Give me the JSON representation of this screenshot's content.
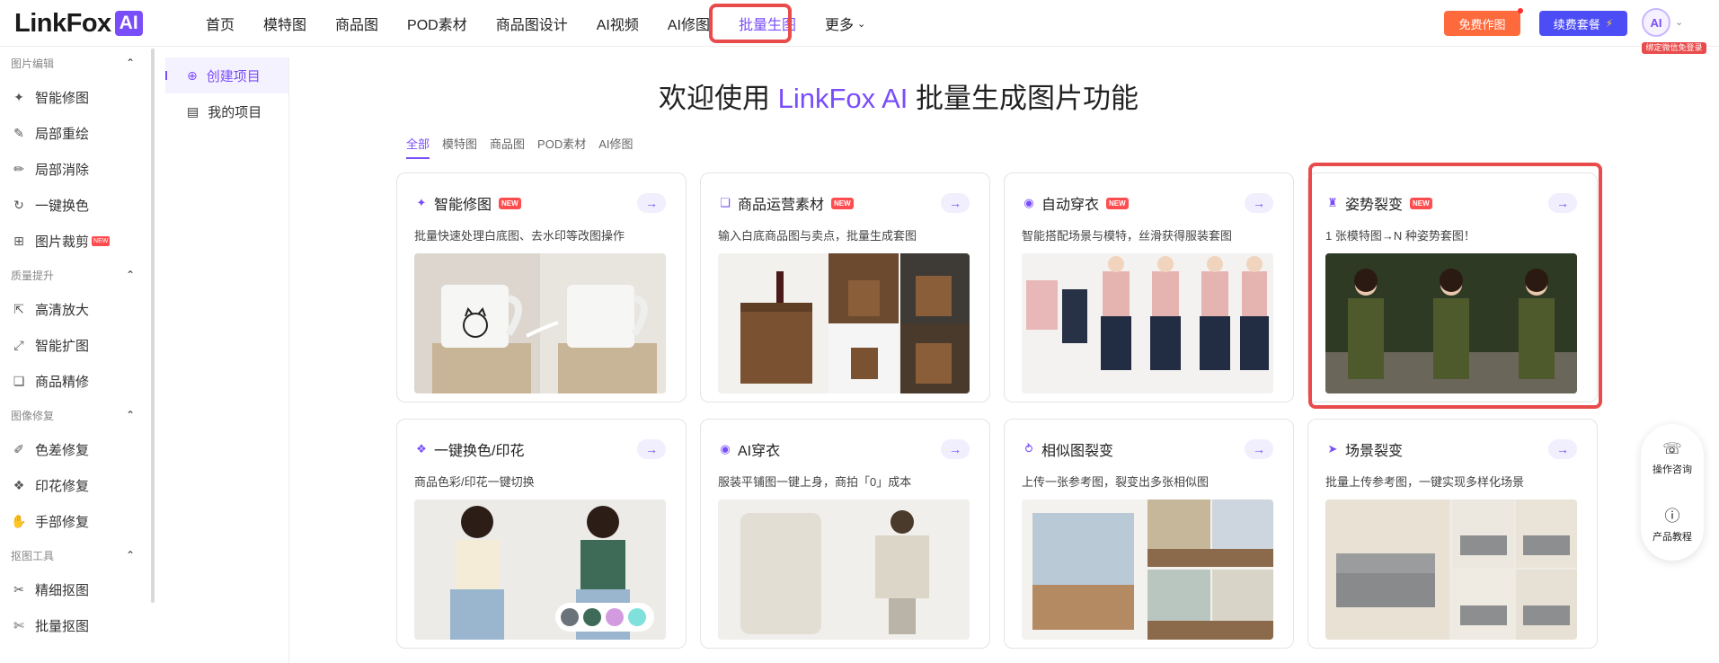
{
  "brand": {
    "name": "LinkFox",
    "ai_badge": "AI"
  },
  "nav": {
    "items": [
      "首页",
      "模特图",
      "商品图",
      "POD素材",
      "商品图设计",
      "AI视频",
      "AI修图",
      "批量生图",
      "更多"
    ],
    "active": "批量生图"
  },
  "header": {
    "free_button": "免费作图",
    "renew_button": "续费套餐",
    "avatar_text": "AI",
    "avatar_badge": "绑定微信免登录"
  },
  "sidebar": {
    "groups": [
      {
        "title": "图片编辑",
        "items": [
          {
            "label": "智能修图",
            "icon": "magic-wand-icon"
          },
          {
            "label": "局部重绘",
            "icon": "brush-icon"
          },
          {
            "label": "局部消除",
            "icon": "eraser-icon"
          },
          {
            "label": "一键换色",
            "icon": "color-swap-icon"
          },
          {
            "label": "图片裁剪",
            "icon": "crop-icon",
            "new": "NEW"
          }
        ]
      },
      {
        "title": "质量提升",
        "items": [
          {
            "label": "高清放大",
            "icon": "upscale-icon"
          },
          {
            "label": "智能扩图",
            "icon": "expand-icon"
          },
          {
            "label": "商品精修",
            "icon": "retouch-icon"
          }
        ]
      },
      {
        "title": "图像修复",
        "items": [
          {
            "label": "色差修复",
            "icon": "color-fix-icon"
          },
          {
            "label": "印花修复",
            "icon": "print-fix-icon"
          },
          {
            "label": "手部修复",
            "icon": "hand-icon"
          }
        ]
      },
      {
        "title": "抠图工具",
        "items": [
          {
            "label": "精细抠图",
            "icon": "cutout-icon"
          },
          {
            "label": "批量抠图",
            "icon": "batch-cutout-icon"
          }
        ]
      }
    ]
  },
  "projects": {
    "create": "创建项目",
    "mine": "我的项目"
  },
  "main": {
    "title_prefix": "欢迎使用",
    "title_brand": "LinkFox AI",
    "title_suffix": "批量生成图片功能",
    "filters": [
      "全部",
      "模特图",
      "商品图",
      "POD素材",
      "AI修图"
    ],
    "active_filter": "全部"
  },
  "cards": [
    {
      "title": "智能修图",
      "new": "NEW",
      "desc": "批量快速处理白底图、去水印等改图操作",
      "icon": "magic-wand-icon"
    },
    {
      "title": "商品运营素材",
      "new": "NEW",
      "desc": "输入白底商品图与卖点，批量生成套图",
      "icon": "material-icon"
    },
    {
      "title": "自动穿衣",
      "new": "NEW",
      "desc": "智能搭配场景与模特，丝滑获得服装套图",
      "icon": "shirt-icon"
    },
    {
      "title": "姿势裂变",
      "new": "NEW",
      "desc": "1 张模特图→N 种姿势套图！",
      "icon": "pose-icon"
    },
    {
      "title": "一键换色/印花",
      "new": "",
      "desc": "商品色彩/印花一键切换",
      "icon": "palette-icon"
    },
    {
      "title": "AI穿衣",
      "new": "",
      "desc": "服装平铺图一键上身，商拍「0」成本",
      "icon": "ai-shirt-icon"
    },
    {
      "title": "相似图裂变",
      "new": "",
      "desc": "上传一张参考图，裂变出多张相似图",
      "icon": "similar-icon"
    },
    {
      "title": "场景裂变",
      "new": "",
      "desc": "批量上传参考图，一键实现多样化场景",
      "icon": "scene-icon"
    }
  ],
  "help": {
    "consult": "操作咨询",
    "tutorial": "产品教程"
  },
  "colors": {
    "accent": "#7a4dfa",
    "highlight": "#e94b4b",
    "free": "#ff6a3d",
    "renew": "#4d4df5"
  }
}
